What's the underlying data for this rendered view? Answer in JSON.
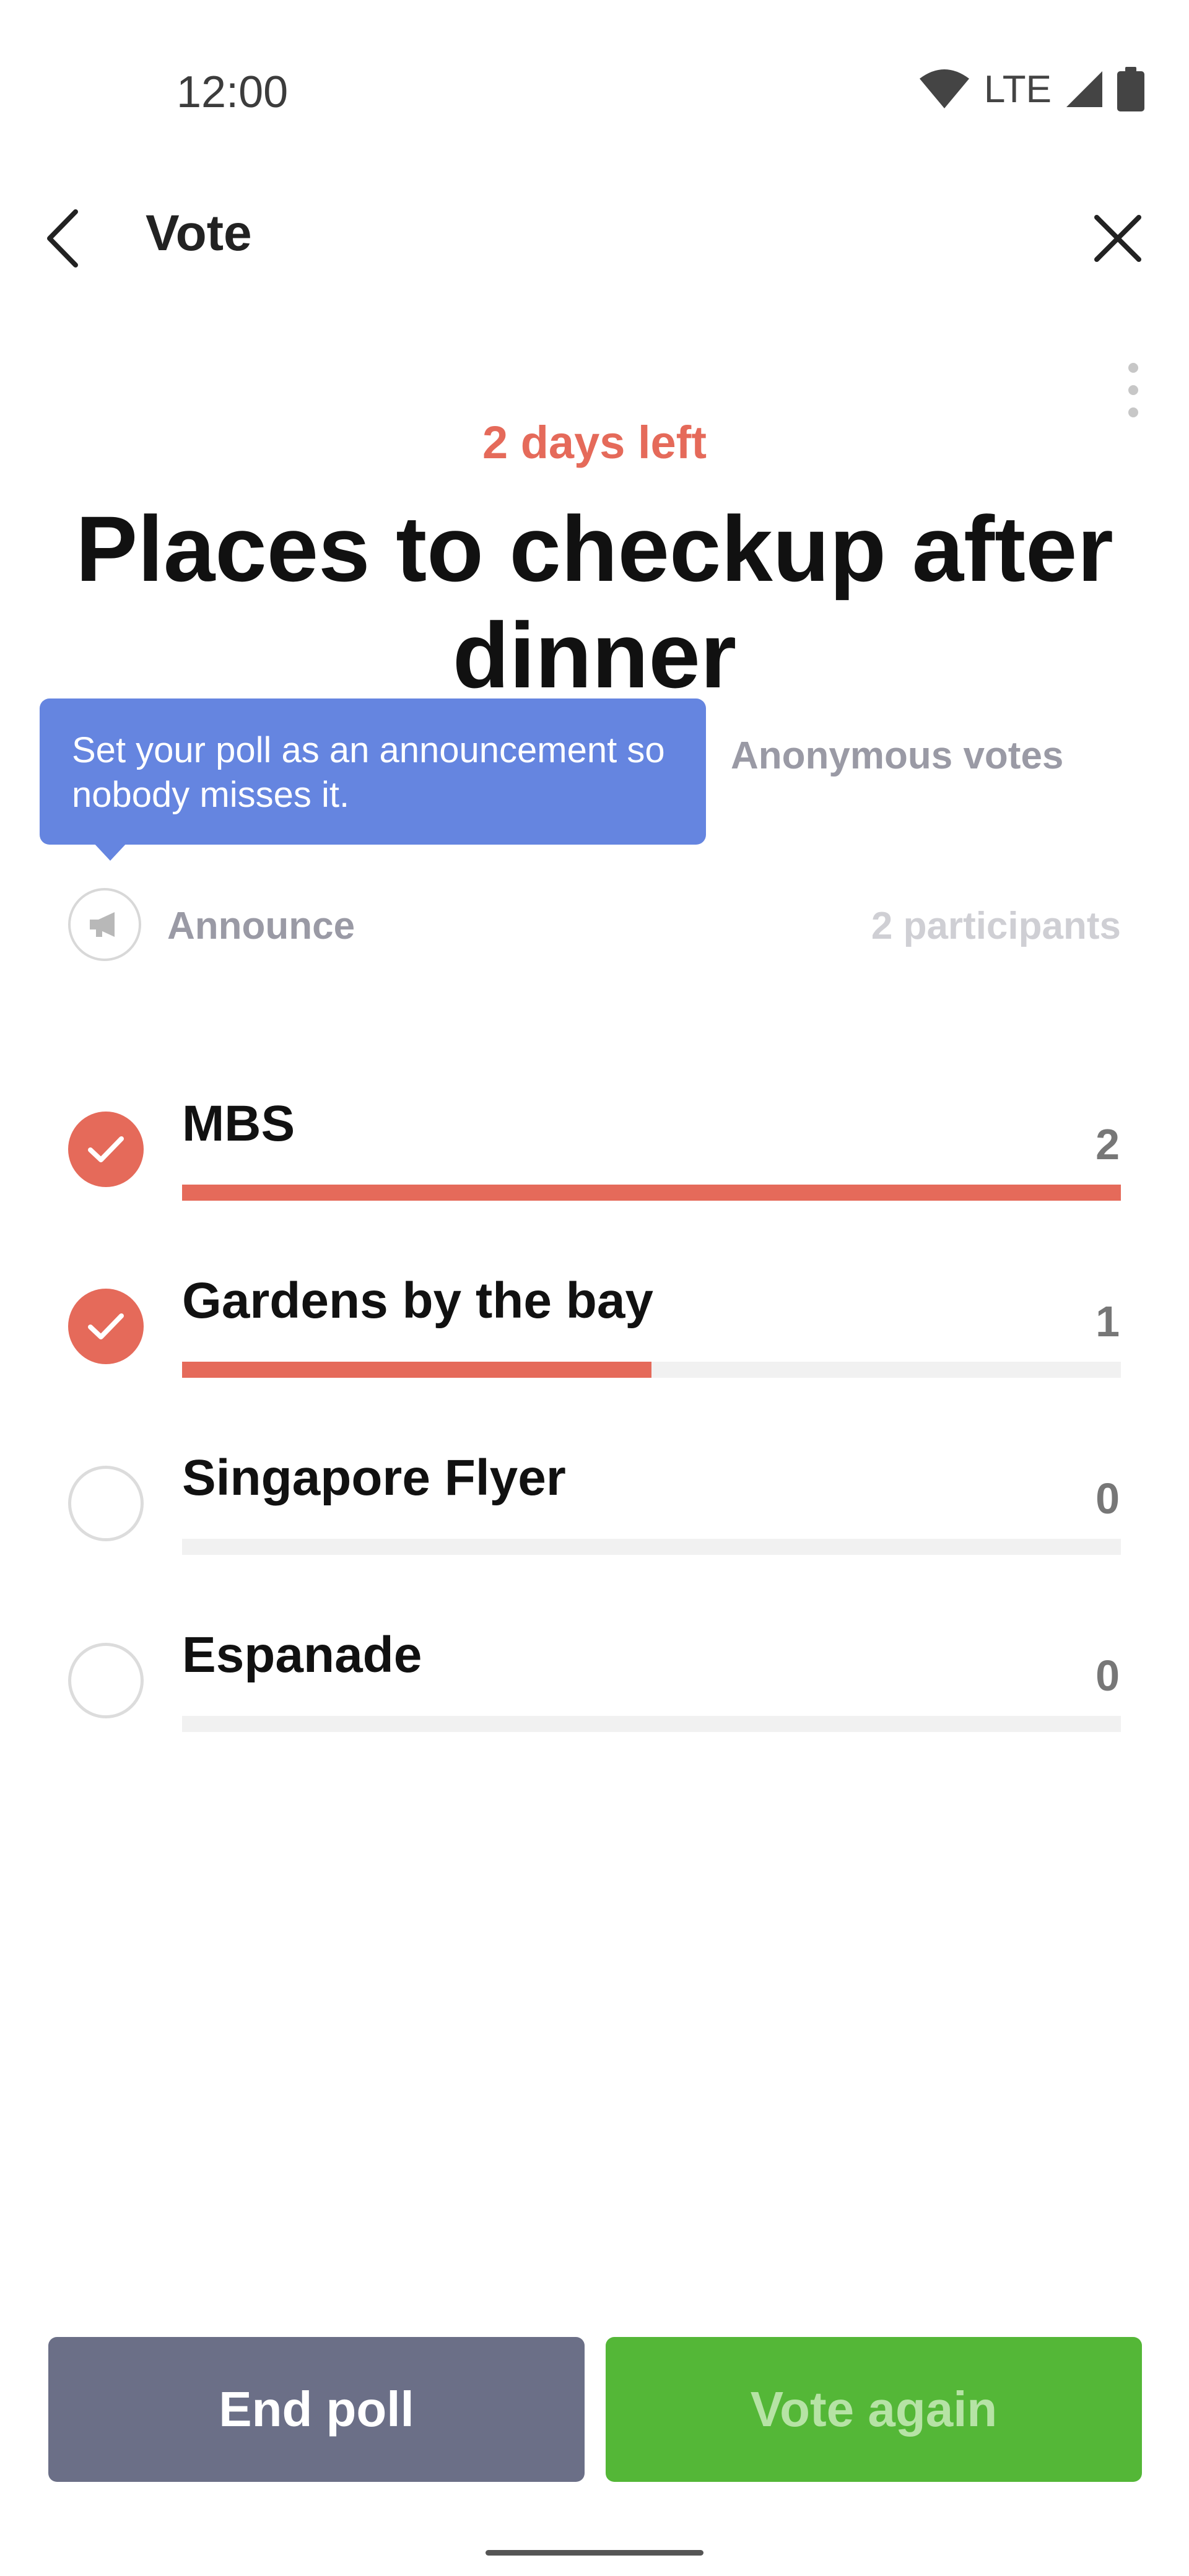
{
  "status_bar": {
    "time": "12:00",
    "network": "LTE",
    "icons": [
      "wifi-icon",
      "signal-icon",
      "battery-icon"
    ]
  },
  "header": {
    "title": "Vote",
    "icons": [
      "back-arrow-icon",
      "close-icon",
      "more-vertical-icon"
    ]
  },
  "poll": {
    "time_left": "2 days left",
    "title": "Places to checkup after dinner",
    "anonymous_label": "Anonymous votes",
    "tooltip": "Set your poll as an announcement so nobody misses it.",
    "announce_label": "Announce",
    "participants": "2 participants",
    "accent_color": "#e56a5a",
    "options": [
      {
        "label": "MBS",
        "count": "2",
        "selected": true,
        "fraction": 1.0
      },
      {
        "label": "Gardens by the bay",
        "count": "1",
        "selected": true,
        "fraction": 0.5
      },
      {
        "label": "Singapore Flyer",
        "count": "0",
        "selected": false,
        "fraction": 0
      },
      {
        "label": "Espanade",
        "count": "0",
        "selected": false,
        "fraction": 0
      }
    ]
  },
  "actions": {
    "end_poll": "End poll",
    "vote_again": "Vote again"
  }
}
